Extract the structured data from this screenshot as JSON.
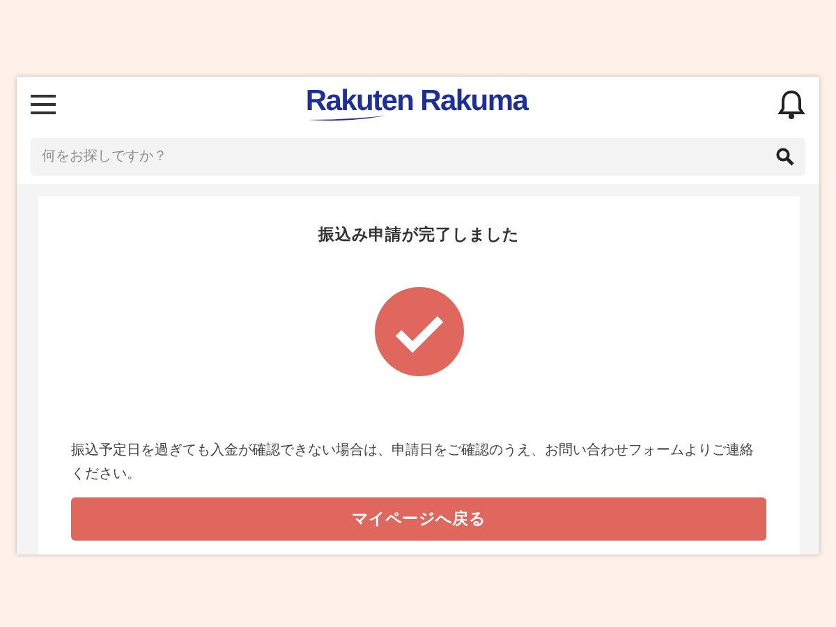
{
  "header": {
    "logo": "Rakuten Rakuma"
  },
  "search": {
    "placeholder": "何をお探しですか？"
  },
  "card": {
    "title": "振込み申請が完了しました",
    "message": "振込予定日を過ぎても入金が確認できない場合は、申請日をご確認のうえ、お問い合わせフォームよりご連絡ください。",
    "button": "マイページへ戻る"
  }
}
